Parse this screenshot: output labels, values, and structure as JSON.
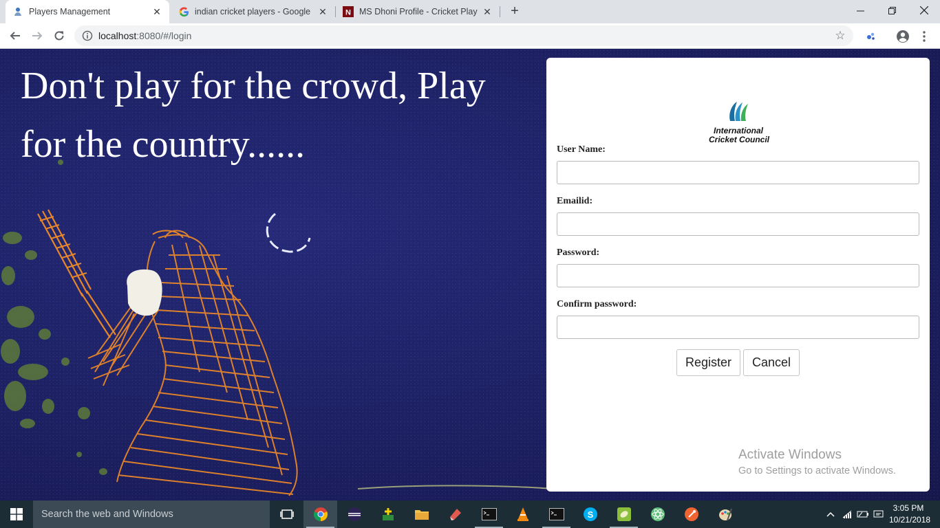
{
  "browser": {
    "tabs": [
      {
        "title": "Players Management",
        "active": true,
        "icon": "players-favicon"
      },
      {
        "title": "indian cricket players - Google Se",
        "active": false,
        "icon": "google-favicon"
      },
      {
        "title": "MS Dhoni Profile - Cricket Player",
        "active": false,
        "icon": "ndtv-favicon"
      }
    ],
    "address": {
      "host": "localhost",
      "rest": ":8080/#/login"
    }
  },
  "page": {
    "quote_line1": "Don't play for the crowd, Play",
    "quote_line2": "for the country......",
    "logo": {
      "line1": "International",
      "line2": "Cricket Council"
    },
    "form": {
      "username_label": "User Name:",
      "email_label": "Emailid:",
      "password_label": "Password:",
      "confirm_label": "Confirm password:",
      "username_value": "",
      "email_value": "",
      "password_value": "",
      "confirm_value": "",
      "register_label": "Register",
      "cancel_label": "Cancel"
    }
  },
  "watermark": {
    "title": "Activate Windows",
    "subtitle": "Go to Settings to activate Windows."
  },
  "taskbar": {
    "search_placeholder": "Search the web and Windows",
    "time": "3:05 PM",
    "date": "10/21/2018"
  },
  "colors": {
    "page_bg": "#1f2368",
    "batsman": "#e8862a",
    "taskbar": "#1d2d36"
  }
}
